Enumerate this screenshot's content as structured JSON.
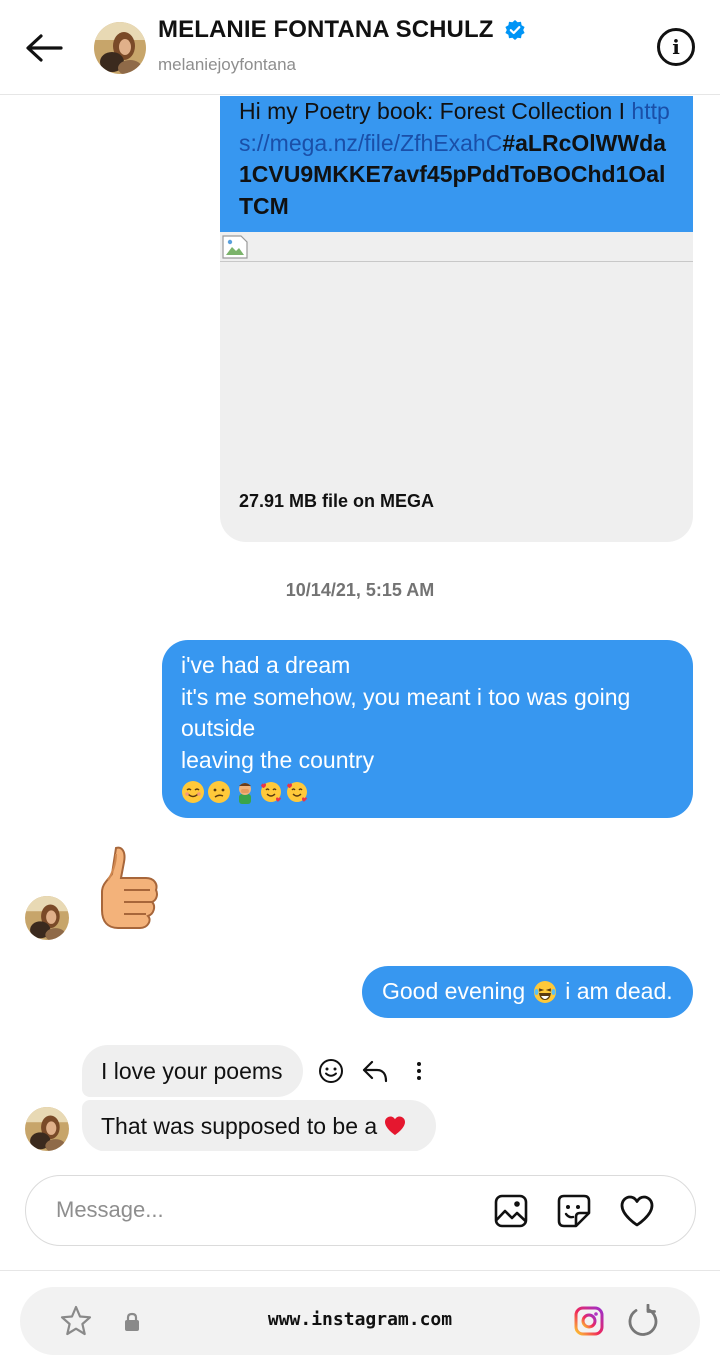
{
  "header": {
    "back_icon": "arrow-left-icon",
    "name": "MELANIE FONTANA SCHULZ",
    "verified_icon": "verified-badge-icon",
    "username": "melaniejoyfontana",
    "info_icon": "info-icon"
  },
  "messages": {
    "link_card": {
      "intro": "Hi my Poetry book: Forest Collection I ",
      "url": "https://mega.nz/file/ZfhExahC",
      "url_tail": "#aLRcOlWWda1CVU9MKKE7avf45pPddToBOChd1OalTCM",
      "file_caption": "27.91 MB file on MEGA"
    },
    "timestamp": "10/14/21, 5:15 AM",
    "dream": {
      "lines": [
        "i've had a dream",
        "it's me somehow, you meant i too was going outside",
        "leaving the country"
      ],
      "emojis": [
        "smiling-face-emoji",
        "confused-face-emoji",
        "man-facepalming-emoji",
        "smiling-face-hearts-emoji",
        "smiling-face-hearts-emoji"
      ]
    },
    "thumbs_up": "thumbs-up-emoji",
    "evening": {
      "before": "Good evening",
      "emoji": "laughing-tears-emoji",
      "after": "i am dead."
    },
    "love_poems": "I love your poems",
    "supposed": {
      "text": "That was supposed to be a",
      "emoji": "red-heart-emoji"
    },
    "actions": [
      "emoji-react-icon",
      "reply-icon",
      "more-icon"
    ]
  },
  "composer": {
    "placeholder": "Message...",
    "icons": [
      "image-icon",
      "sticker-icon",
      "heart-icon"
    ]
  },
  "browser": {
    "url": "www.instagram.com",
    "icons": [
      "star-icon",
      "lock-icon",
      "instagram-icon",
      "reload-icon"
    ]
  },
  "colors": {
    "accent_blue": "#3797f0",
    "incoming_bubble": "#efefef",
    "verified_blue": "#0095f6"
  }
}
